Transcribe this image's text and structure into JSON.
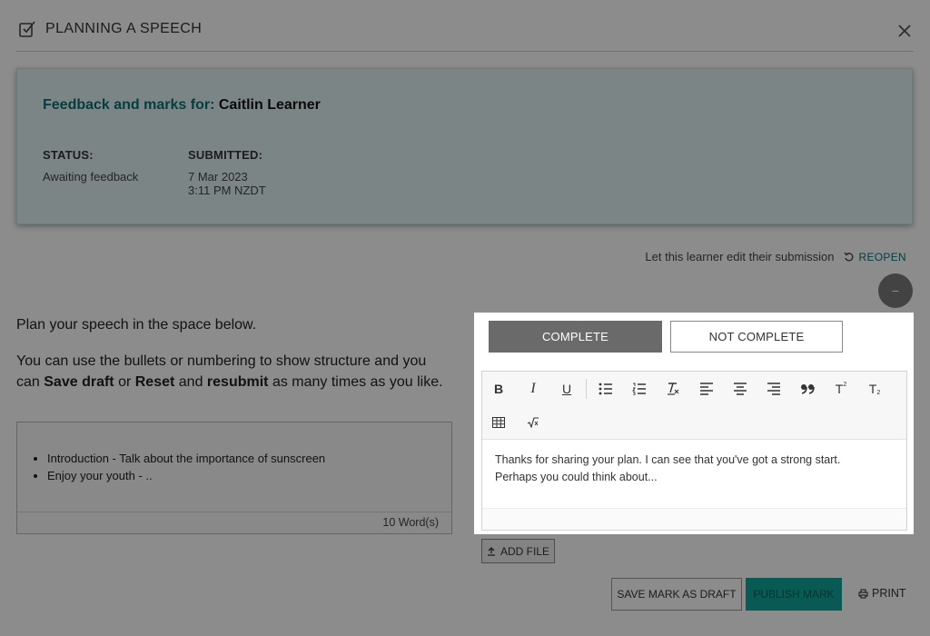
{
  "header": {
    "title": "PLANNING A SPEECH",
    "task_icon": "task-check-icon",
    "close_icon": "close-icon"
  },
  "feedback": {
    "title_prefix": "Feedback and marks for:",
    "learner_name": "Caitlin Learner",
    "status_label": "STATUS:",
    "status_value": "Awaiting feedback",
    "submitted_label": "SUBMITTED:",
    "submitted_date": "7 Mar 2023",
    "submitted_time": "3:11 PM NZDT"
  },
  "reopen": {
    "description": "Let this learner edit their submission",
    "button_label": "REOPEN",
    "icon": "undo-icon"
  },
  "collapse": {
    "label": "−"
  },
  "instructions": {
    "line1": "Plan your speech in the space below.",
    "p2_a": "You can use the bullets or numbering to show structure and you can ",
    "p2_b": "Save draft",
    "p2_c": " or ",
    "p2_d": "Reset",
    "p2_e": " and ",
    "p2_f": "resubmit",
    "p2_g": " as many times as you like."
  },
  "submission": {
    "items": [
      "Introduction - Talk about the importance of sunscreen",
      "Enjoy your youth - .."
    ],
    "word_count": "10 Word(s)"
  },
  "marking": {
    "complete_label": "COMPLETE",
    "not_complete_label": "NOT COMPLETE",
    "toolbar": {
      "bold": "B",
      "italic": "I",
      "underline": "U",
      "superscript": "T",
      "subscript": "T"
    },
    "feedback_line1": "Thanks for sharing your plan. I can see that you've got a strong start.",
    "feedback_line2": "Perhaps you could think about..."
  },
  "actions": {
    "add_file": "ADD FILE",
    "save_draft": "SAVE MARK AS DRAFT",
    "publish": "PUBLISH MARK",
    "print": "PRINT"
  },
  "colors": {
    "teal": "#0b6f74",
    "publish": "#11a49c",
    "complete_bg": "#6a6a6a"
  }
}
